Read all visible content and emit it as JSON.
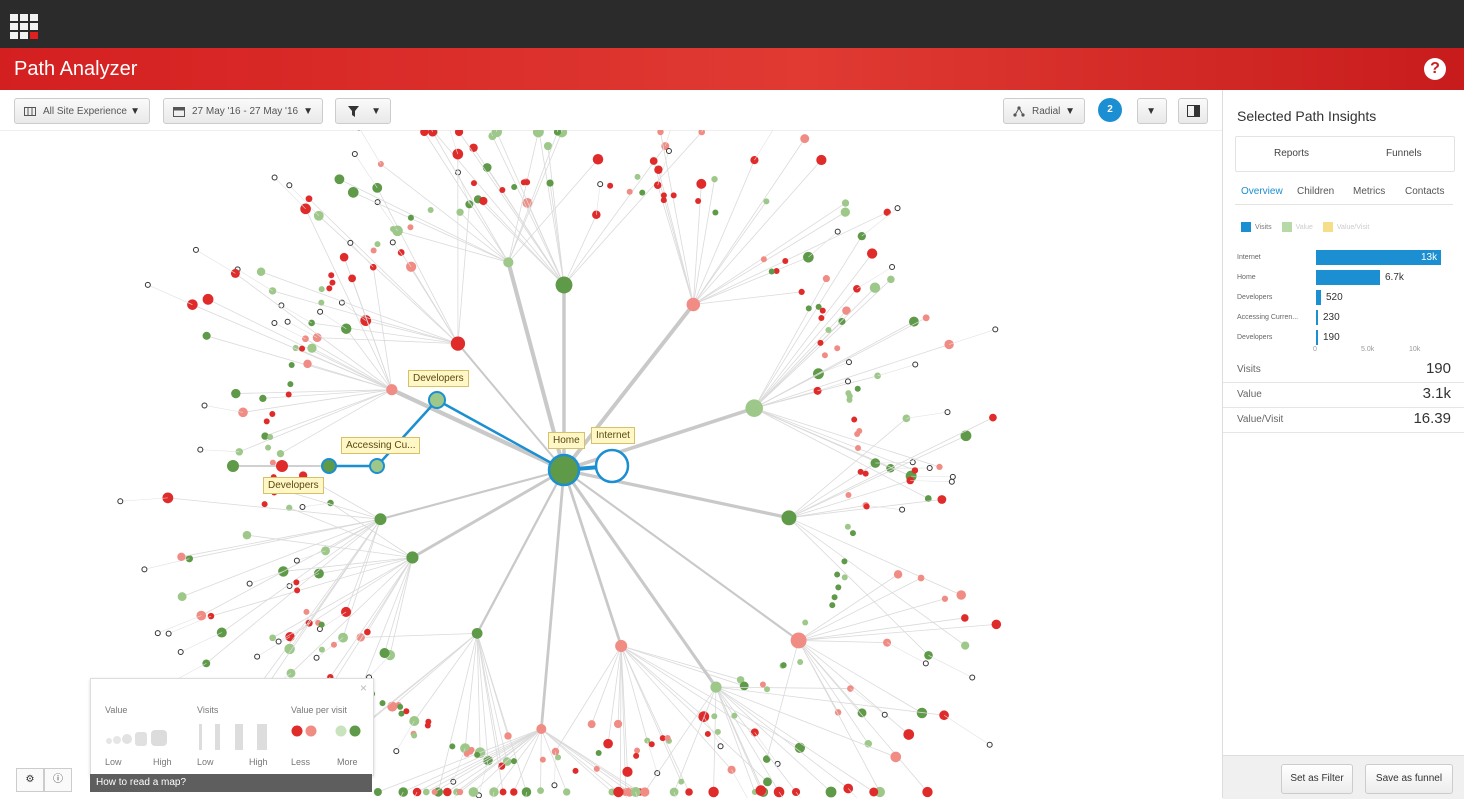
{
  "app": {
    "title": "Path Analyzer",
    "help_label": "?"
  },
  "toolbar": {
    "site_filter": "All Site Experience",
    "date_range": "27 May '16 - 27 May '16",
    "layout": "Radial",
    "badge_count": "2"
  },
  "map": {
    "labels": {
      "developers_top": "Developers",
      "accessing": "Accessing Cu...",
      "developers_left": "Developers",
      "home": "Home",
      "internet": "Internet"
    }
  },
  "panel": {
    "title": "Selected Path Insights",
    "tabs_primary": [
      "Reports",
      "Funnels"
    ],
    "tabs_secondary": [
      "Overview",
      "Children",
      "Metrics",
      "Contacts"
    ],
    "legend": [
      "Visits",
      "Value",
      "Value/Visit"
    ],
    "bars": [
      {
        "label": "Internet",
        "value": 13000,
        "display": "13k"
      },
      {
        "label": "Home",
        "value": 6700,
        "display": "6.7k"
      },
      {
        "label": "Developers",
        "value": 520,
        "display": "520"
      },
      {
        "label": "Accessing Curren...",
        "value": 230,
        "display": "230"
      },
      {
        "label": "Developers",
        "value": 190,
        "display": "190"
      }
    ],
    "axis_ticks": [
      "0",
      "5.0k",
      "10k"
    ],
    "stats": [
      {
        "key": "Visits",
        "value": "190"
      },
      {
        "key": "Value",
        "value": "3.1k"
      },
      {
        "key": "Value/Visit",
        "value": "16.39"
      }
    ],
    "buttons": {
      "filter": "Set as Filter",
      "funnel": "Save as funnel"
    }
  },
  "legend_box": {
    "value": "Value",
    "visits": "Visits",
    "value_per_visit": "Value per visit",
    "low": "Low",
    "high": "High",
    "low2": "Low",
    "high2": "High",
    "less": "Less",
    "more": "More",
    "close": "×",
    "howto": "How to read a map?"
  },
  "colors": {
    "accent": "#1b8fd1",
    "brand_red": "#d41f20",
    "node_red": "#e02b2b",
    "node_pink": "#f08c84",
    "node_green": "#5e9a48",
    "node_light_green": "#9dc88a"
  }
}
